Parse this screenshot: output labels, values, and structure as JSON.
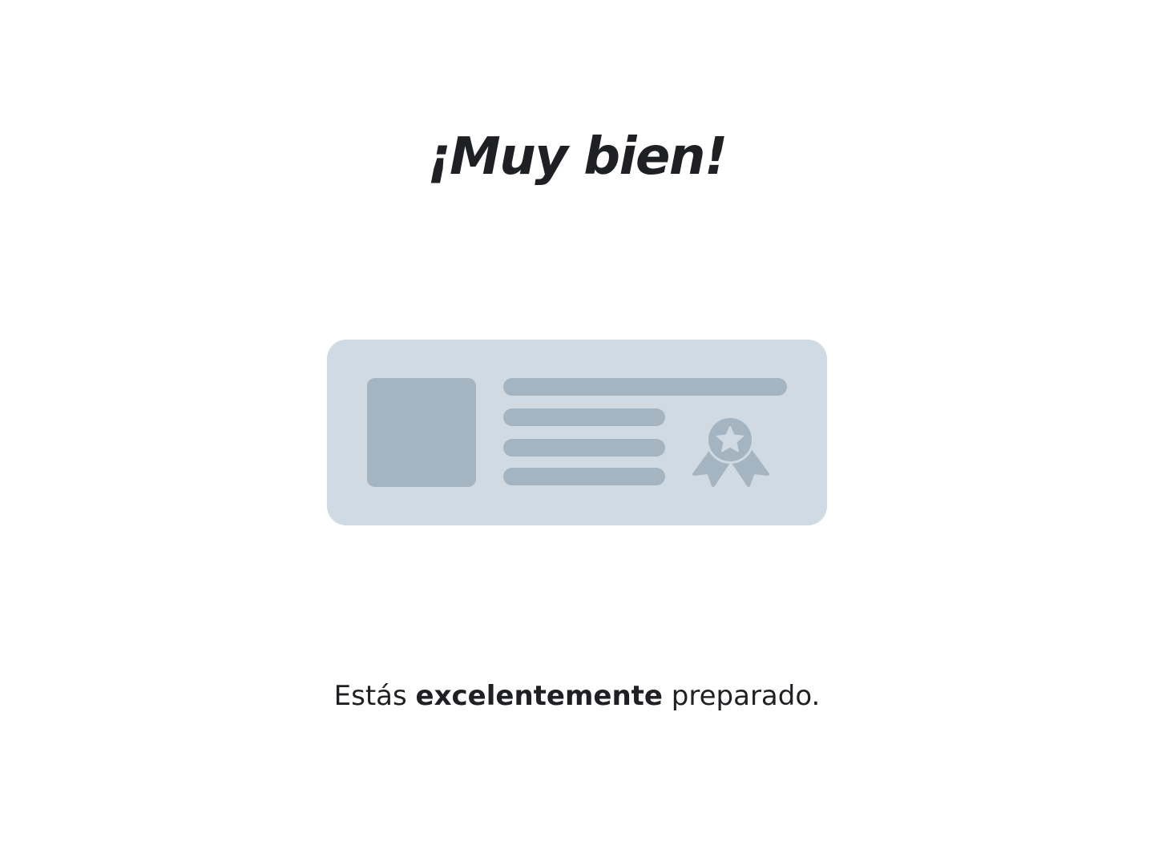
{
  "headline": "¡Muy bien!",
  "illustration": {
    "icon": "certificate-icon",
    "badge_icon": "award-ribbon-icon",
    "colors": {
      "card": "#cfdae2",
      "shapes": "#a5b4c1"
    }
  },
  "message": {
    "prefix": "Estás",
    "emphasis": "excelentemente",
    "suffix": "preparado."
  },
  "colors": {
    "text": "#1f2023",
    "background": "#ffffff"
  }
}
